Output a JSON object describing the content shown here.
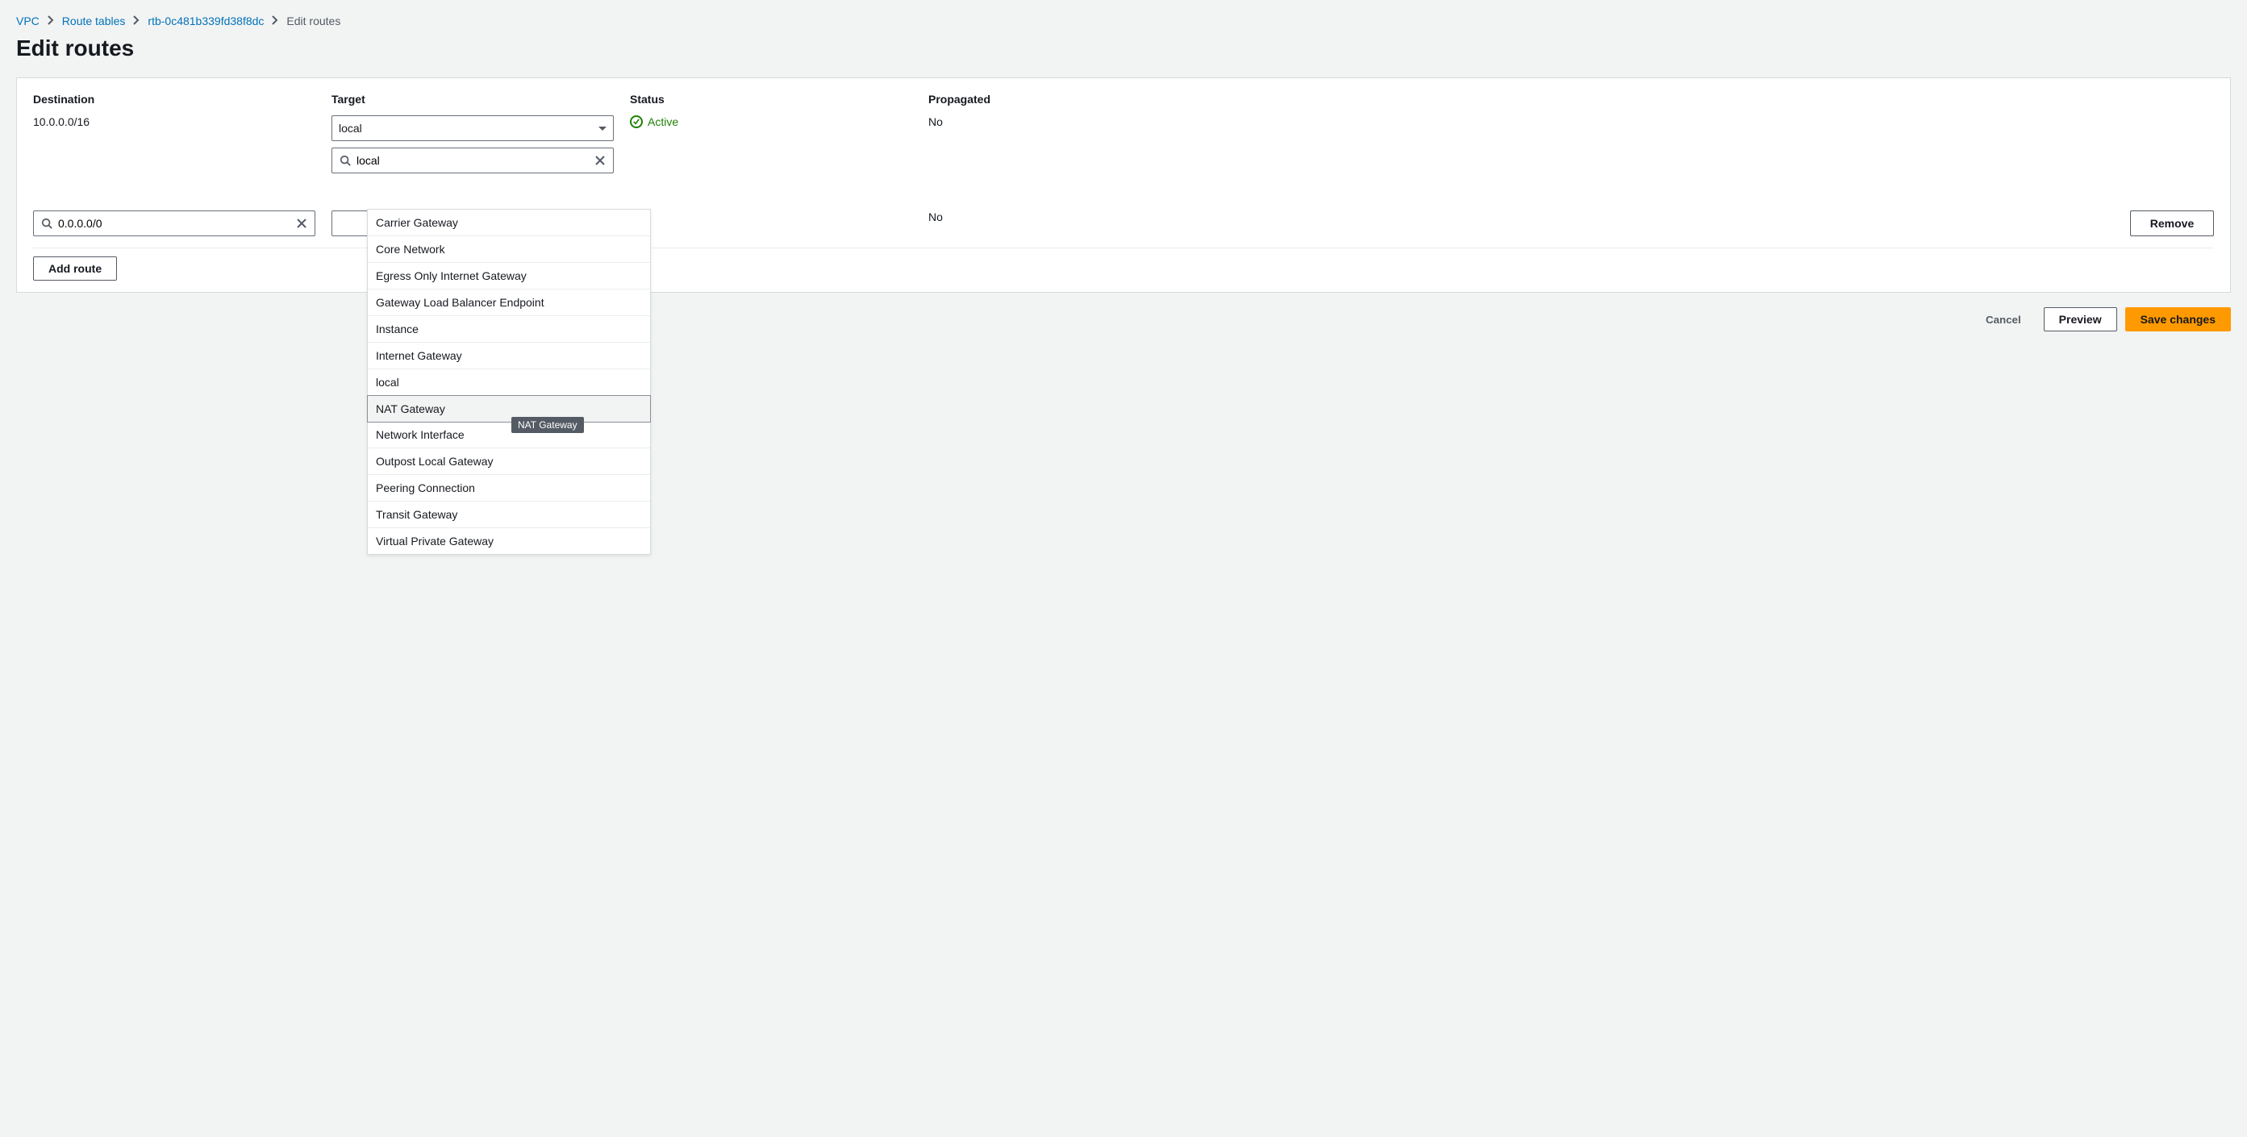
{
  "breadcrumb": {
    "items": [
      {
        "label": "VPC",
        "link": true
      },
      {
        "label": "Route tables",
        "link": true
      },
      {
        "label": "rtb-0c481b339fd38f8dc",
        "link": true
      },
      {
        "label": "Edit routes",
        "link": false
      }
    ]
  },
  "page": {
    "title": "Edit routes"
  },
  "columns": {
    "destination": "Destination",
    "target": "Target",
    "status": "Status",
    "propagated": "Propagated"
  },
  "routes": [
    {
      "destination": "10.0.0.0/16",
      "target_select_value": "local",
      "target_search_value": "local",
      "status": "Active",
      "status_dash": "",
      "propagated": "No"
    },
    {
      "destination_input": "0.0.0.0/0",
      "target_select_value": "",
      "status_dash": "–",
      "propagated": "No",
      "remove_label": "Remove"
    }
  ],
  "dropdown": {
    "options": [
      "Carrier Gateway",
      "Core Network",
      "Egress Only Internet Gateway",
      "Gateway Load Balancer Endpoint",
      "Instance",
      "Internet Gateway",
      "local",
      "NAT Gateway",
      "Network Interface",
      "Outpost Local Gateway",
      "Peering Connection",
      "Transit Gateway",
      "Virtual Private Gateway"
    ],
    "highlighted_index": 7,
    "tooltip_on_index": 8,
    "tooltip_text": "NAT Gateway"
  },
  "actions": {
    "add_route": "Add route",
    "cancel": "Cancel",
    "preview": "Preview",
    "save": "Save changes"
  }
}
